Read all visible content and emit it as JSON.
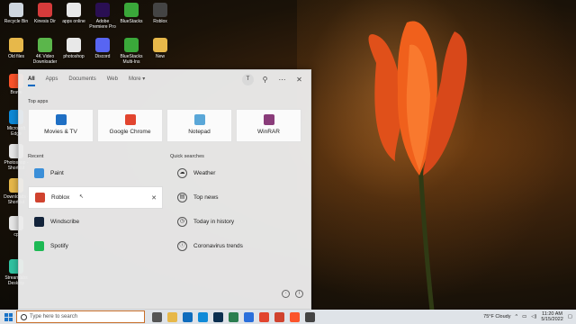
{
  "desktop_icons": [
    {
      "label": "Recycle Bin",
      "color": "#cfd6de"
    },
    {
      "label": "Kinesis Dir",
      "color": "#d63b3b"
    },
    {
      "label": "apps online",
      "color": "#e8e8e8"
    },
    {
      "label": "Adobe Premiere Pro",
      "color": "#2a0f53"
    },
    {
      "label": "BlueStacks",
      "color": "#3aa83a"
    },
    {
      "label": "Roblox",
      "color": "#444"
    },
    {
      "label": "Old files",
      "color": "#e7b84a"
    },
    {
      "label": "4K Video Downloader",
      "color": "#5bb64b"
    },
    {
      "label": "photoshop",
      "color": "#e8e8e8"
    },
    {
      "label": "Discord",
      "color": "#5865f2"
    },
    {
      "label": "BlueStacks Multi-Ins",
      "color": "#3aa83a"
    },
    {
      "label": "New",
      "color": "#e7b84a"
    },
    {
      "label": "Brave",
      "color": "#fb542b"
    },
    {
      "label": "Microsoft Edge",
      "color": "#0f8ad8"
    },
    {
      "label": "Photoshop - Shortcut",
      "color": "#e8e8e8"
    },
    {
      "label": "Downloads - Shortcut",
      "color": "#e7b84a"
    },
    {
      "label": "cp",
      "color": "#e8e8e8"
    },
    {
      "label": "Streamlabs Desktop",
      "color": "#31c3a2"
    }
  ],
  "menu": {
    "tabs": [
      "All",
      "Apps",
      "Documents",
      "Web",
      "More ▾"
    ],
    "avatar": "T",
    "top_apps_heading": "Top apps",
    "top_apps": [
      {
        "label": "Movies & TV",
        "color": "#1f6fc4"
      },
      {
        "label": "Google Chrome",
        "color": "#e2452f"
      },
      {
        "label": "Notepad",
        "color": "#5aa7d8"
      },
      {
        "label": "WinRAR",
        "color": "#8a3c7a"
      }
    ],
    "recent_heading": "Recent",
    "recent": [
      {
        "label": "Paint",
        "color": "#3b8fd8"
      },
      {
        "label": "Roblox",
        "color": "#d0432f"
      },
      {
        "label": "Windscribe",
        "color": "#13243b"
      },
      {
        "label": "Spotify",
        "color": "#1db954"
      }
    ],
    "quick_heading": "Quick searches",
    "quick": [
      {
        "label": "Weather",
        "icon": "☁"
      },
      {
        "label": "Top news",
        "icon": "▤"
      },
      {
        "label": "Today in history",
        "icon": "◷"
      },
      {
        "label": "Coronavirus trends",
        "icon": "ⓘ"
      }
    ]
  },
  "taskbar": {
    "search_placeholder": "Type here to search",
    "weather": "75°F  Cloudy",
    "time": "11:20 AM",
    "date": "5/15/2022",
    "apps": [
      {
        "name": "task-view",
        "color": "#555"
      },
      {
        "name": "file-explorer",
        "color": "#e7b84a"
      },
      {
        "name": "mail",
        "color": "#0f6cbd"
      },
      {
        "name": "edge",
        "color": "#0f8ad8"
      },
      {
        "name": "photoshop",
        "color": "#0b2f50"
      },
      {
        "name": "camera",
        "color": "#2a7d4f"
      },
      {
        "name": "store",
        "color": "#2a6fdb"
      },
      {
        "name": "chrome",
        "color": "#e2452f"
      },
      {
        "name": "roblox",
        "color": "#d0432f"
      },
      {
        "name": "brave",
        "color": "#fb542b"
      },
      {
        "name": "roblox-studio",
        "color": "#444"
      }
    ]
  },
  "colors": {
    "accent": "#0067c0",
    "search_border": "#c86f2a"
  }
}
